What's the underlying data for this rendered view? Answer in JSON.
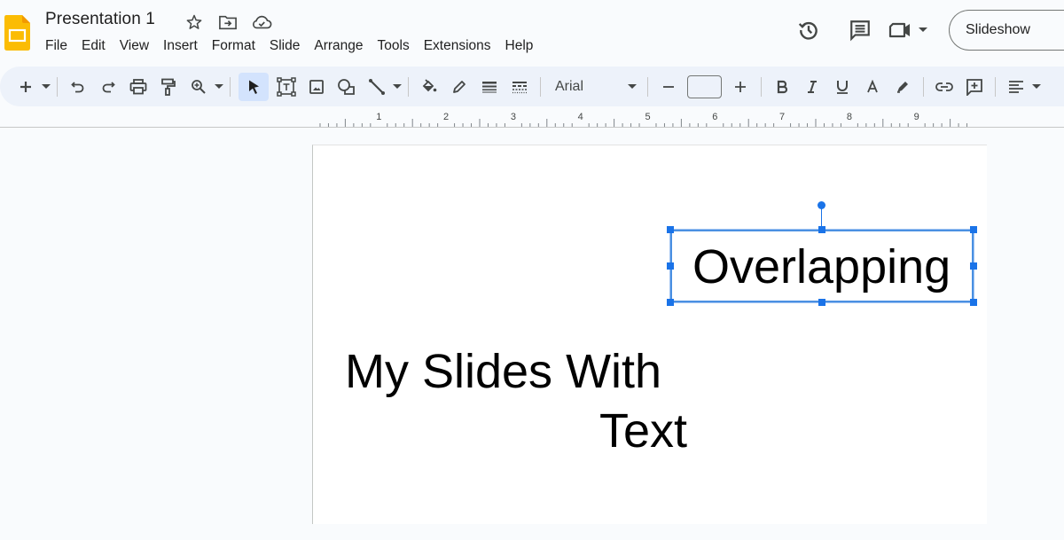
{
  "app": {
    "name": "Google Slides",
    "document_title": "Presentation 1",
    "accent_color": "#1a73e8",
    "logo_color": "#fbbc04"
  },
  "title_icons": [
    "star-icon",
    "move-to-folder-icon",
    "cloud-saved-icon"
  ],
  "menu": [
    "File",
    "Edit",
    "View",
    "Insert",
    "Format",
    "Slide",
    "Arrange",
    "Tools",
    "Extensions",
    "Help"
  ],
  "header_right": {
    "version_history_icon": "history-icon",
    "comments_icon": "comments-icon",
    "meet_icon": "video-camera-icon",
    "slideshow_label": "Slideshow"
  },
  "toolbar": {
    "font_name": "Arial",
    "font_size": "",
    "buttons": [
      "new-slide",
      "undo",
      "redo",
      "print",
      "paint-format",
      "zoom",
      "select",
      "text-box",
      "image",
      "shape",
      "line",
      "fill-color",
      "border-color",
      "border-weight",
      "border-dash",
      "decrease-font-size",
      "increase-font-size",
      "bold",
      "italic",
      "underline",
      "text-color",
      "highlight-color",
      "insert-link",
      "add-comment",
      "align"
    ]
  },
  "ruler": {
    "labels": [
      "1",
      "2",
      "3",
      "4",
      "5",
      "6",
      "7",
      "8",
      "9"
    ]
  },
  "slide": {
    "selected_textbox": "Overlapping",
    "title_line1": "My Slides With",
    "title_line2": "Text"
  }
}
